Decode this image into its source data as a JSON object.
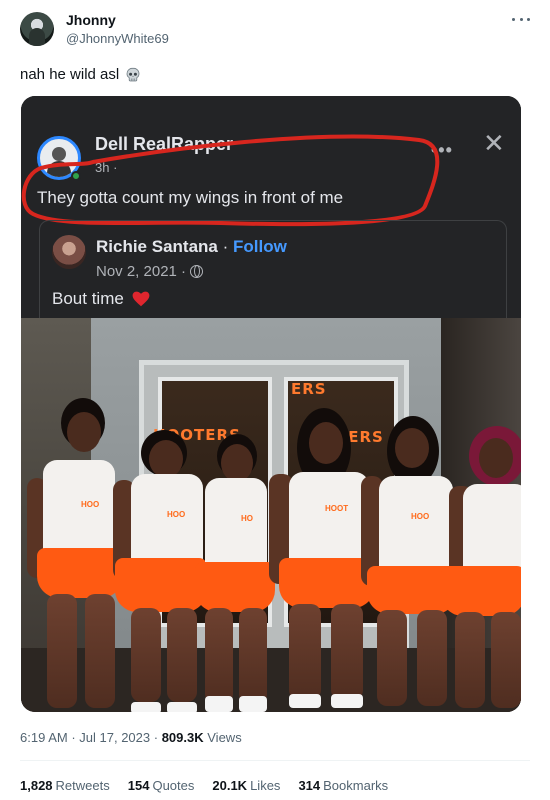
{
  "author": {
    "display_name": "Jhonny",
    "handle": "@JhonnyWhite69"
  },
  "tweet": {
    "text": "nah he wild asl",
    "emoji_icon": "skull-icon"
  },
  "embedded_post": {
    "poster_name": "Dell RealRapper",
    "time": "3h ·",
    "text": "They gotta count my wings in front of me",
    "highlight_color": "#d7261e",
    "shared": {
      "name": "Richie Santana",
      "follow_sep": " · ",
      "follow_label": "Follow",
      "date": "Nov 2, 2021 ·",
      "text": "Bout time"
    },
    "photo_signs": [
      "HOOTERS",
      "ERS",
      "TERS"
    ]
  },
  "meta": {
    "time": "6:19 AM",
    "date": "Jul 17, 2023",
    "views": "809.3K",
    "views_label": "Views"
  },
  "stats": [
    {
      "value": "1,828",
      "label": "Retweets"
    },
    {
      "value": "154",
      "label": "Quotes"
    },
    {
      "value": "20.1K",
      "label": "Likes"
    },
    {
      "value": "314",
      "label": "Bookmarks"
    }
  ],
  "colors": {
    "accent_follow": "#4599ff",
    "shorts": "#ff5a12"
  }
}
